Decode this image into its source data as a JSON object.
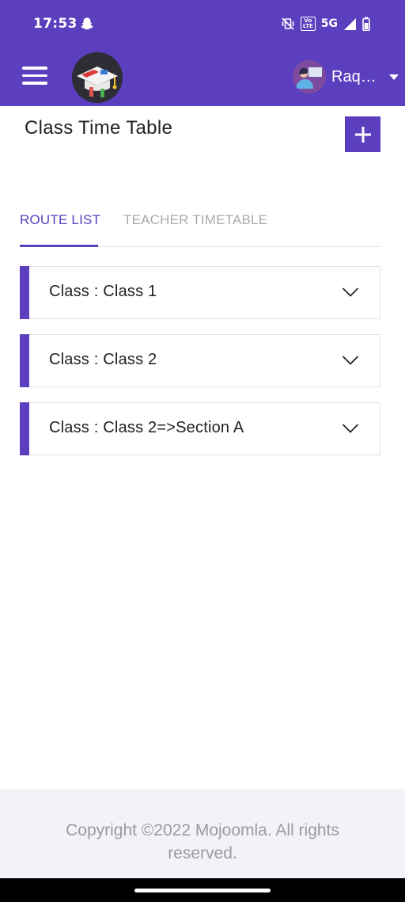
{
  "status_bar": {
    "time": "17:53",
    "network": "5G",
    "volte_top": "Vo",
    "volte_bottom": "LTE"
  },
  "app_bar": {
    "user_name": "Raq…"
  },
  "page": {
    "title": "Class Time Table"
  },
  "tabs": [
    {
      "label": "ROUTE LIST",
      "active": true
    },
    {
      "label": "TEACHER TIMETABLE",
      "active": false
    }
  ],
  "classes": [
    {
      "label": "Class : Class 1"
    },
    {
      "label": "Class : Class 2"
    },
    {
      "label": "Class : Class 2=>Section A"
    }
  ],
  "footer": {
    "copyright": "Copyright ©2022 Mojoomla. All rights reserved."
  },
  "colors": {
    "primary": "#5b3fbf",
    "footer_bg": "#f1f3f8",
    "tab_inactive": "#a9a9a9"
  }
}
